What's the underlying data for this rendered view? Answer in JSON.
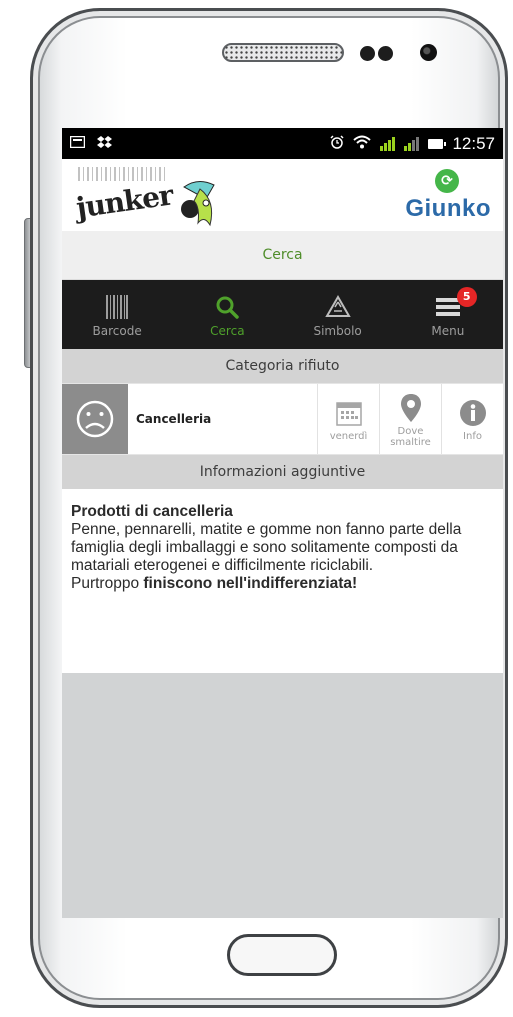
{
  "status_bar": {
    "time": "12:57"
  },
  "brand": {
    "left_logo_text": "junker",
    "right_logo_text": "Giunko"
  },
  "header": {
    "title": "Cerca"
  },
  "tabs": [
    {
      "label": "Barcode",
      "icon": "barcode-icon",
      "active": false
    },
    {
      "label": "Cerca",
      "icon": "search-icon",
      "active": true
    },
    {
      "label": "Simbolo",
      "icon": "recycle-warning-icon",
      "active": false
    },
    {
      "label": "Menu",
      "icon": "menu-icon",
      "active": false,
      "badge": "5"
    }
  ],
  "category_section": {
    "heading": "Categoria rifiuto",
    "name": "Cancelleria",
    "actions": [
      {
        "label": "venerdì",
        "icon": "calendar-icon"
      },
      {
        "label": "Dove smaltire",
        "icon": "location-pin-icon"
      },
      {
        "label": "Info",
        "icon": "info-icon"
      }
    ]
  },
  "extra_info": {
    "heading": "Informazioni aggiuntive",
    "title": "Prodotti di cancelleria",
    "body": "Penne, pennarelli, matite e gomme non fanno parte della famiglia degli imballaggi e sono solitamente composti da matariali eterogenei e difficilmente riciclabili.",
    "closing_prefix": "Purtroppo ",
    "closing_bold": "finiscono nell'indifferenziata!"
  },
  "colors": {
    "accent_green": "#4fa12b",
    "tabbar_bg": "#1c1c1c",
    "badge_red": "#e52626",
    "section_grey": "#d3d3d3"
  }
}
